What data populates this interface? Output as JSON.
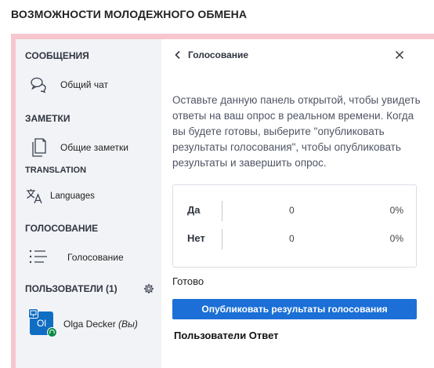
{
  "page_title": "ВОЗМОЖНОСТИ МОЛОДЕЖНОГО ОБМЕНА",
  "sidebar": {
    "messages_heading": "СООБЩЕНИЯ",
    "public_chat_label": "Общий чат",
    "notes_heading": "ЗАМЕТКИ",
    "shared_notes_label": "Общие заметки",
    "translation_heading": "TRANSLATION",
    "languages_label": "Languages",
    "voting_heading": "ГОЛОСОВАНИЕ",
    "voting_label": "Голосование",
    "users_heading": "ПОЛЬЗОВАТЕЛИ (1)",
    "current_user": {
      "initials": "Ol",
      "name": "Olga Decker",
      "suffix": "(Вы)"
    }
  },
  "panel": {
    "title": "Голосование",
    "instructions": "Оставьте данную панель открытой, чтобы увидеть ответы на ваш опрос в реальном времени. Когда вы будете готовы, выберите \"опубликовать результаты голосования\", чтобы опубликовать результаты и завершить опрос.",
    "results": [
      {
        "option": "Да",
        "count": "0",
        "percent": "0%"
      },
      {
        "option": "Нет",
        "count": "0",
        "percent": "0%"
      }
    ],
    "done_label": "Готово",
    "publish_button": "Опубликовать результаты голосования",
    "responses_header": "Пользователи Ответ"
  },
  "colors": {
    "accent_blue": "#1b6fd6",
    "frame_pink": "#f7c6ce",
    "sidebar_bg": "#f1f3f6",
    "avatar_bg": "#0f6dc2",
    "online_badge": "#0a8a4a"
  }
}
